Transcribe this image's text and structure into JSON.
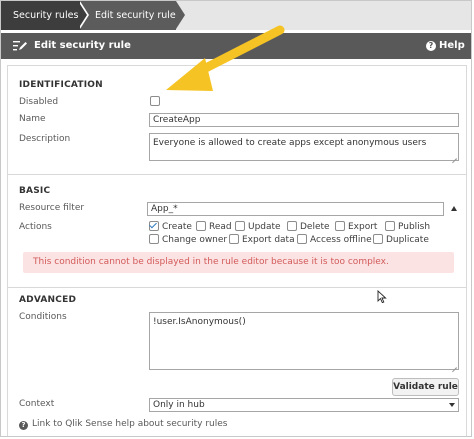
{
  "breadcrumb": [
    "Security rules",
    "Edit security rule"
  ],
  "header": {
    "title": "Edit security rule",
    "help_label": "Help",
    "help_glyph": "?"
  },
  "identification": {
    "title": "IDENTIFICATION",
    "disabled_label": "Disabled",
    "disabled_checked": false,
    "name_label": "Name",
    "name_value": "CreateApp",
    "description_label": "Description",
    "description_value": "Everyone is allowed to create apps except anonymous users"
  },
  "basic": {
    "title": "BASIC",
    "resource_filter_label": "Resource filter",
    "resource_filter_value": "App_*",
    "actions_label": "Actions",
    "actions": [
      {
        "label": "Create",
        "checked": true
      },
      {
        "label": "Read",
        "checked": false
      },
      {
        "label": "Update",
        "checked": false
      },
      {
        "label": "Delete",
        "checked": false
      },
      {
        "label": "Export",
        "checked": false
      },
      {
        "label": "Publish",
        "checked": false
      },
      {
        "label": "Change owner",
        "checked": false
      },
      {
        "label": "Export data",
        "checked": false
      },
      {
        "label": "Access offline",
        "checked": false
      },
      {
        "label": "Duplicate",
        "checked": false
      }
    ],
    "error_message": "This condition cannot be displayed in the rule editor because it is too complex."
  },
  "advanced": {
    "title": "ADVANCED",
    "conditions_label": "Conditions",
    "conditions_value": "!user.IsAnonymous()",
    "validate_label": "Validate rule",
    "context_label": "Context",
    "context_value": "Only in hub",
    "help_link": "Link to Qlik Sense help about security rules",
    "help_glyph": "?"
  },
  "colors": {
    "header_bg": "#595959",
    "breadcrumb_active_bg": "#3d3d3d",
    "error_bg": "#fbe3e3",
    "error_text": "#d35a5a",
    "annotation_arrow": "#f5c324"
  },
  "annotation": {
    "icon": "arrow-pointer-icon"
  }
}
